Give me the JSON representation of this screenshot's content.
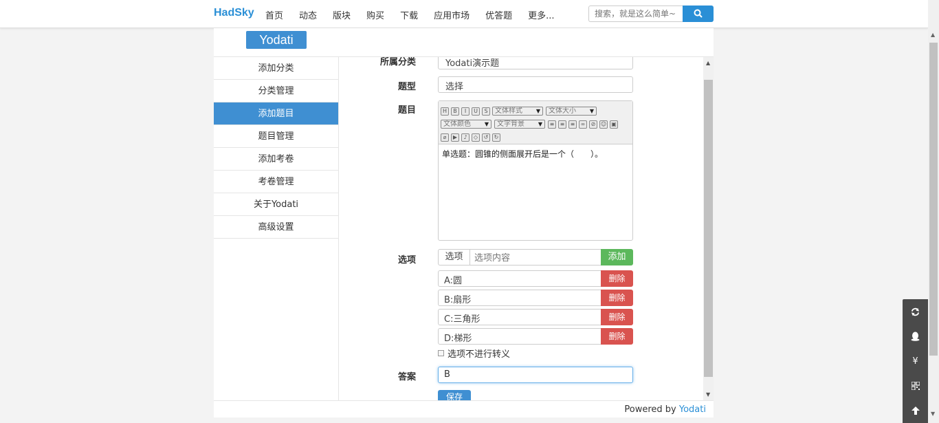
{
  "navbar": {
    "brand": "HadSky",
    "links": [
      "首页",
      "动态",
      "版块",
      "购买",
      "下载",
      "应用市场",
      "优答题",
      "更多..."
    ],
    "search_placeholder": "搜索，就是这么简单~"
  },
  "app": {
    "title": "Yodati",
    "sidebar": [
      {
        "label": "添加分类",
        "active": false
      },
      {
        "label": "分类管理",
        "active": false
      },
      {
        "label": "添加题目",
        "active": true
      },
      {
        "label": "题目管理",
        "active": false
      },
      {
        "label": "添加考卷",
        "active": false
      },
      {
        "label": "考卷管理",
        "active": false
      },
      {
        "label": "关于Yodati",
        "active": false
      },
      {
        "label": "高级设置",
        "active": false
      }
    ]
  },
  "form": {
    "category_label": "所属分类",
    "category_value": "Yodati演示题",
    "type_label": "题型",
    "type_value": "选择",
    "question_label": "题目",
    "editor": {
      "selects": [
        "文体样式",
        "文体大小",
        "文体颜色",
        "文字背景"
      ],
      "content": "单选题：圆锥的侧面展开后是一个（　　）。"
    },
    "options_label": "选项",
    "option_prefix": "选项",
    "option_placeholder": "选项内容",
    "add_label": "添加",
    "options": [
      "A:圆",
      "B:扇形",
      "C:三角形",
      "D:梯形"
    ],
    "delete_label": "删除",
    "no_escape_label": "选项不进行转义",
    "answer_label": "答案",
    "answer_value": "B",
    "save_label": "保存"
  },
  "footer": {
    "powered_by": "Powered by ",
    "link": "Yodati"
  },
  "float_buttons": [
    "refresh-icon",
    "qq-icon",
    "yen-icon",
    "qrcode-icon",
    "arrow-up-icon"
  ],
  "colors": {
    "accent": "#3f8fd2",
    "success": "#5cb85c",
    "danger": "#d9534f"
  }
}
